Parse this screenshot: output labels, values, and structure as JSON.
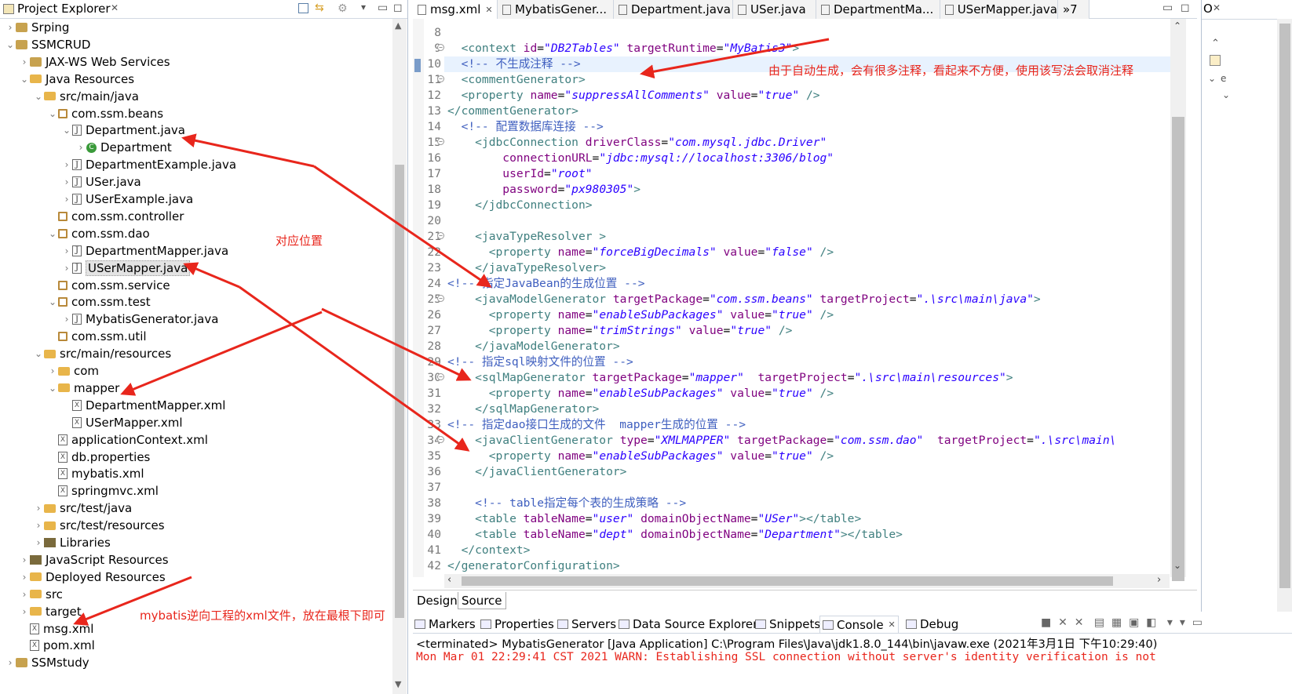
{
  "project_explorer": {
    "title": "Project Explorer",
    "tree": [
      {
        "label": "Srping",
        "depth": 0,
        "icon": "project",
        "tw": "›"
      },
      {
        "label": "SSMCRUD",
        "depth": 0,
        "icon": "project",
        "tw": "⌄"
      },
      {
        "label": "JAX-WS Web Services",
        "depth": 1,
        "icon": "service",
        "tw": "›"
      },
      {
        "label": "Java Resources",
        "depth": 1,
        "icon": "folder",
        "tw": "⌄"
      },
      {
        "label": "src/main/java",
        "depth": 2,
        "icon": "folder",
        "tw": "⌄"
      },
      {
        "label": "com.ssm.beans",
        "depth": 3,
        "icon": "package",
        "tw": "⌄"
      },
      {
        "label": "Department.java",
        "depth": 4,
        "icon": "java",
        "tw": "⌄"
      },
      {
        "label": "Department",
        "depth": 5,
        "icon": "class",
        "tw": "›"
      },
      {
        "label": "DepartmentExample.java",
        "depth": 4,
        "icon": "java",
        "tw": "›"
      },
      {
        "label": "USer.java",
        "depth": 4,
        "icon": "java",
        "tw": "›"
      },
      {
        "label": "USerExample.java",
        "depth": 4,
        "icon": "java",
        "tw": "›"
      },
      {
        "label": "com.ssm.controller",
        "depth": 3,
        "icon": "package",
        "tw": ""
      },
      {
        "label": "com.ssm.dao",
        "depth": 3,
        "icon": "package",
        "tw": "⌄"
      },
      {
        "label": "DepartmentMapper.java",
        "depth": 4,
        "icon": "java",
        "tw": "›"
      },
      {
        "label": "USerMapper.java",
        "depth": 4,
        "icon": "java",
        "tw": "›",
        "selected": true
      },
      {
        "label": "com.ssm.service",
        "depth": 3,
        "icon": "package",
        "tw": ""
      },
      {
        "label": "com.ssm.test",
        "depth": 3,
        "icon": "package",
        "tw": "⌄"
      },
      {
        "label": "MybatisGenerator.java",
        "depth": 4,
        "icon": "java",
        "tw": "›"
      },
      {
        "label": "com.ssm.util",
        "depth": 3,
        "icon": "package",
        "tw": ""
      },
      {
        "label": "src/main/resources",
        "depth": 2,
        "icon": "folder",
        "tw": "⌄"
      },
      {
        "label": "com",
        "depth": 3,
        "icon": "folder",
        "tw": "›"
      },
      {
        "label": "mapper",
        "depth": 3,
        "icon": "folder",
        "tw": "⌄"
      },
      {
        "label": "DepartmentMapper.xml",
        "depth": 4,
        "icon": "xml",
        "tw": ""
      },
      {
        "label": "USerMapper.xml",
        "depth": 4,
        "icon": "xml",
        "tw": ""
      },
      {
        "label": "applicationContext.xml",
        "depth": 3,
        "icon": "xml",
        "tw": ""
      },
      {
        "label": "db.properties",
        "depth": 3,
        "icon": "xml",
        "tw": ""
      },
      {
        "label": "mybatis.xml",
        "depth": 3,
        "icon": "xml",
        "tw": ""
      },
      {
        "label": "springmvc.xml",
        "depth": 3,
        "icon": "xml",
        "tw": ""
      },
      {
        "label": "src/test/java",
        "depth": 2,
        "icon": "folder",
        "tw": "›"
      },
      {
        "label": "src/test/resources",
        "depth": 2,
        "icon": "folder",
        "tw": "›"
      },
      {
        "label": "Libraries",
        "depth": 2,
        "icon": "library",
        "tw": "›"
      },
      {
        "label": "JavaScript Resources",
        "depth": 1,
        "icon": "library",
        "tw": "›"
      },
      {
        "label": "Deployed Resources",
        "depth": 1,
        "icon": "folder",
        "tw": "›"
      },
      {
        "label": "src",
        "depth": 1,
        "icon": "folder",
        "tw": "›"
      },
      {
        "label": "target",
        "depth": 1,
        "icon": "folder",
        "tw": "›"
      },
      {
        "label": "msg.xml",
        "depth": 1,
        "icon": "xml",
        "tw": ""
      },
      {
        "label": "pom.xml",
        "depth": 1,
        "icon": "xml",
        "tw": ""
      },
      {
        "label": "SSMstudy",
        "depth": 0,
        "icon": "project",
        "tw": "›"
      }
    ]
  },
  "editor": {
    "tabs": [
      {
        "label": "msg.xml",
        "active": true,
        "close": "✕"
      },
      {
        "label": "MybatisGener..."
      },
      {
        "label": "Department.java"
      },
      {
        "label": "USer.java"
      },
      {
        "label": "DepartmentMa..."
      },
      {
        "label": "USerMapper.java"
      },
      {
        "label": "»7"
      }
    ],
    "lines": [
      {
        "n": "8",
        "html": ""
      },
      {
        "n": "9",
        "fold": true,
        "html": "  <span class=t>&lt;context</span> <span class=a>id</span>=<span class=v>\"DB2Tables\"</span> <span class=a>targetRuntime</span>=<span class=v>\"MyBatis3\"</span><span class=t>&gt;</span>"
      },
      {
        "n": "10",
        "hl": true,
        "html": "  <span class=c>&lt;!-- 不生成注释 --&gt;</span>"
      },
      {
        "n": "11",
        "fold": true,
        "html": "  <span class=t>&lt;commentGenerator&gt;</span>"
      },
      {
        "n": "12",
        "html": "  <span class=t>&lt;property</span> <span class=a>name</span>=<span class=v>\"suppressAllComments\"</span> <span class=a>value</span>=<span class=v>\"true\"</span> <span class=t>/&gt;</span>"
      },
      {
        "n": "13",
        "html": "<span class=t>&lt;/commentGenerator&gt;</span>"
      },
      {
        "n": "14",
        "html": "  <span class=c>&lt;!-- 配置数据库连接 --&gt;</span>"
      },
      {
        "n": "15",
        "fold": true,
        "html": "    <span class=t>&lt;jdbcConnection</span> <span class=a>driverClass</span>=<span class=v>\"com.mysql.jdbc.Driver\"</span>"
      },
      {
        "n": "16",
        "html": "        <span class=a>connectionURL</span>=<span class=v>\"jdbc:mysql://localhost:3306/blog\"</span>"
      },
      {
        "n": "17",
        "html": "        <span class=a>userId</span>=<span class=v>\"root\"</span>"
      },
      {
        "n": "18",
        "html": "        <span class=a>password</span>=<span class=v>\"px980305\"</span><span class=t>&gt;</span>"
      },
      {
        "n": "19",
        "html": "    <span class=t>&lt;/jdbcConnection&gt;</span>"
      },
      {
        "n": "20",
        "html": ""
      },
      {
        "n": "21",
        "fold": true,
        "html": "    <span class=t>&lt;javaTypeResolver &gt;</span>"
      },
      {
        "n": "22",
        "html": "      <span class=t>&lt;property</span> <span class=a>name</span>=<span class=v>\"forceBigDecimals\"</span> <span class=a>value</span>=<span class=v>\"false\"</span> <span class=t>/&gt;</span>"
      },
      {
        "n": "23",
        "html": "    <span class=t>&lt;/javaTypeResolver&gt;</span>"
      },
      {
        "n": "24",
        "html": "<span class=c>&lt;!-- 指定JavaBean的生成位置 --&gt;</span>"
      },
      {
        "n": "25",
        "fold": true,
        "html": "    <span class=t>&lt;javaModelGenerator</span> <span class=a>targetPackage</span>=<span class=v>\"com.ssm.beans\"</span> <span class=a>targetProject</span>=<span class=v>\".\\src\\main\\java\"</span><span class=t>&gt;</span>"
      },
      {
        "n": "26",
        "html": "      <span class=t>&lt;property</span> <span class=a>name</span>=<span class=v>\"enableSubPackages\"</span> <span class=a>value</span>=<span class=v>\"true\"</span> <span class=t>/&gt;</span>"
      },
      {
        "n": "27",
        "html": "      <span class=t>&lt;property</span> <span class=a>name</span>=<span class=v>\"trimStrings\"</span> <span class=a>value</span>=<span class=v>\"true\"</span> <span class=t>/&gt;</span>"
      },
      {
        "n": "28",
        "html": "    <span class=t>&lt;/javaModelGenerator&gt;</span>"
      },
      {
        "n": "29",
        "html": "<span class=c>&lt;!-- 指定sql映射文件的位置 --&gt;</span>"
      },
      {
        "n": "30",
        "fold": true,
        "html": "    <span class=t>&lt;sqlMapGenerator</span> <span class=a>targetPackage</span>=<span class=v>\"mapper\"</span>  <span class=a>targetProject</span>=<span class=v>\".\\src\\main\\resources\"</span><span class=t>&gt;</span>"
      },
      {
        "n": "31",
        "html": "      <span class=t>&lt;property</span> <span class=a>name</span>=<span class=v>\"enableSubPackages\"</span> <span class=a>value</span>=<span class=v>\"true\"</span> <span class=t>/&gt;</span>"
      },
      {
        "n": "32",
        "html": "    <span class=t>&lt;/sqlMapGenerator&gt;</span>"
      },
      {
        "n": "33",
        "html": "<span class=c>&lt;!-- 指定dao接口生成的文件  mapper生成的位置 --&gt;</span>"
      },
      {
        "n": "34",
        "fold": true,
        "html": "    <span class=t>&lt;javaClientGenerator</span> <span class=a>type</span>=<span class=v>\"XMLMAPPER\"</span> <span class=a>targetPackage</span>=<span class=v>\"com.ssm.dao\"</span>  <span class=a>targetProject</span>=<span class=v>\".\\src\\main\\</span>"
      },
      {
        "n": "35",
        "html": "      <span class=t>&lt;property</span> <span class=a>name</span>=<span class=v>\"enableSubPackages\"</span> <span class=a>value</span>=<span class=v>\"true\"</span> <span class=t>/&gt;</span>"
      },
      {
        "n": "36",
        "html": "    <span class=t>&lt;/javaClientGenerator&gt;</span>"
      },
      {
        "n": "37",
        "html": ""
      },
      {
        "n": "38",
        "html": "    <span class=c>&lt;!-- table指定每个表的生成策略 --&gt;</span>"
      },
      {
        "n": "39",
        "html": "    <span class=t>&lt;table</span> <span class=a>tableName</span>=<span class=v>\"user\"</span> <span class=a>domainObjectName</span>=<span class=v>\"USer\"</span><span class=t>&gt;&lt;/table&gt;</span>"
      },
      {
        "n": "40",
        "html": "    <span class=t>&lt;table</span> <span class=a>tableName</span>=<span class=v>\"dept\"</span> <span class=a>domainObjectName</span>=<span class=v>\"Department\"</span><span class=t>&gt;&lt;/table&gt;</span>"
      },
      {
        "n": "41",
        "html": "  <span class=t>&lt;/context&gt;</span>"
      },
      {
        "n": "42",
        "html": "<span class=t>&lt;/generatorConfiguration&gt;</span>"
      }
    ],
    "design_tab": "Design",
    "source_tab": "Source"
  },
  "console": {
    "tabs": [
      "Markers",
      "Properties",
      "Servers",
      "Data Source Explorer",
      "Snippets",
      "Console",
      "Debug"
    ],
    "active": "Console",
    "terminated": "<terminated> MybatisGenerator [Java Application] C:\\Program Files\\Java\\jdk1.8.0_144\\bin\\javaw.exe (2021年3月1日 下午10:29:40)",
    "warn": "Mon Mar 01 22:29:41 CST 2021 WARN: Establishing SSL connection without server's identity verification is not"
  },
  "annotations": {
    "comment_note": "由于自动生成，会有很多注释，看起来不方便，使用该写法会取消注释",
    "position_note": "对应位置",
    "xml_note": "mybatis逆向工程的xml文件，放在最根下即可"
  },
  "colors": {
    "arrow": "#e8261c",
    "tag": "#3f7f7f",
    "attr": "#7f007f",
    "value": "#2a00ff",
    "comment": "#3f5fbf"
  }
}
